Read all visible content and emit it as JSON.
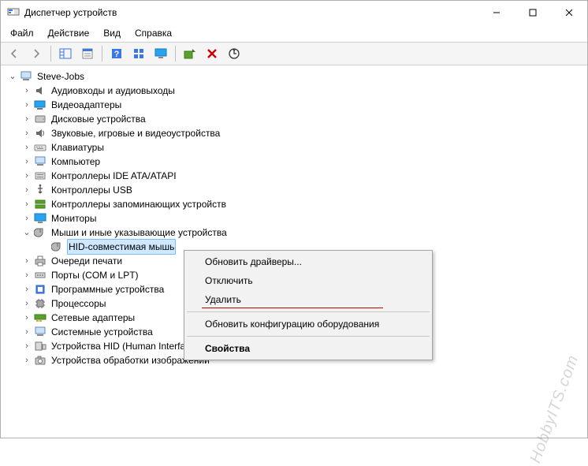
{
  "window": {
    "title": "Диспетчер устройств"
  },
  "menu": {
    "file": "Файл",
    "action": "Действие",
    "view": "Вид",
    "help": "Справка"
  },
  "tree": {
    "root": "Steve-Jobs",
    "n_audio": "Аудиовходы и аудиовыходы",
    "n_video": "Видеоадаптеры",
    "n_disk": "Дисковые устройства",
    "n_sound": "Звуковые, игровые и видеоустройства",
    "n_keyboard": "Клавиатуры",
    "n_computer": "Компьютер",
    "n_ide": "Контроллеры IDE ATA/ATAPI",
    "n_usb": "Контроллеры USB",
    "n_storage": "Контроллеры запоминающих устройств",
    "n_monitor": "Мониторы",
    "n_mouse": "Мыши и иные указывающие устройства",
    "n_hidmouse": "HID-совместимая мышь",
    "n_print": "Очереди печати",
    "n_ports": "Порты (COM и LPT)",
    "n_soft": "Программные устройства",
    "n_cpu": "Процессоры",
    "n_net": "Сетевые адаптеры",
    "n_sys": "Системные устройства",
    "n_hid": "Устройства HID (Human Interface Devices)",
    "n_imaging": "Устройства обработки изображений"
  },
  "ctx": {
    "update": "Обновить драйверы...",
    "disable": "Отключить",
    "delete": "Удалить",
    "scan": "Обновить конфигурацию оборудования",
    "props": "Свойства"
  },
  "watermark": "HobbyITS.com"
}
